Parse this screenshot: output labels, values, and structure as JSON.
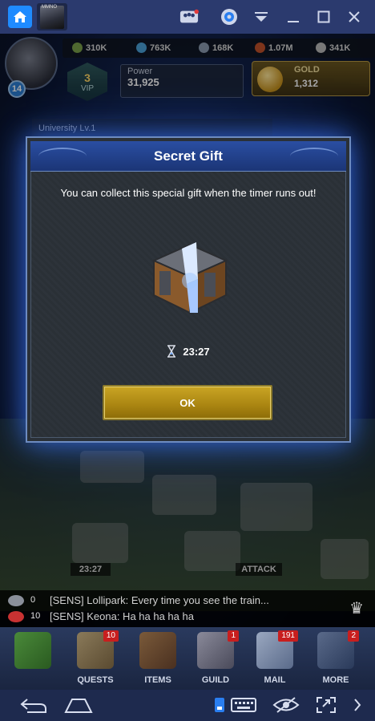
{
  "emulator": {
    "home_icon": "house-icon",
    "app_tab_icon": "game-thumbnail",
    "app_tab_text": "MMNO",
    "toolbar": [
      {
        "name": "multi-instance-icon",
        "glyph": "👥"
      },
      {
        "name": "account-icon",
        "glyph": "●"
      },
      {
        "name": "dropdown-menu-icon",
        "glyph": "▼"
      },
      {
        "name": "minimize-icon",
        "glyph": "—"
      },
      {
        "name": "maximize-icon",
        "glyph": "▢"
      },
      {
        "name": "close-icon",
        "glyph": "✕"
      }
    ]
  },
  "hud": {
    "resources": [
      {
        "name": "food",
        "value": "310K",
        "color": "#7aa04a"
      },
      {
        "name": "stone",
        "value": "763K",
        "color": "#4aa0d8"
      },
      {
        "name": "iron",
        "value": "168K",
        "color": "#8a9ab0"
      },
      {
        "name": "wood",
        "value": "1.07M",
        "color": "#c0502a"
      },
      {
        "name": "silver",
        "value": "341K",
        "color": "#b8b8b8"
      }
    ],
    "level": "14",
    "vip": {
      "value": "3",
      "label": "VIP"
    },
    "power": {
      "label": "Power",
      "value": "31,925"
    },
    "gold": {
      "label": "GOLD",
      "value": "1,312"
    },
    "building_label": "University Lv.1"
  },
  "dialog": {
    "title": "Secret Gift",
    "message": "You can collect this special gift when the timer runs out!",
    "timer_icon": "hourglass-icon",
    "timer": "23:27",
    "ok_label": "OK"
  },
  "map_labels": {
    "timer": "23:27",
    "attack": "ATTACK"
  },
  "chat": {
    "lines": [
      {
        "count": "0",
        "text": "[SENS] Lollipark: Every time you see the train..."
      },
      {
        "count": "10",
        "text": "[SENS] Keona: Ha ha ha ha ha"
      }
    ]
  },
  "nav": [
    {
      "id": "realm",
      "label": "",
      "badge": ""
    },
    {
      "id": "quests",
      "label": "QUESTS",
      "badge": "10"
    },
    {
      "id": "items",
      "label": "ITEMS",
      "badge": ""
    },
    {
      "id": "guild",
      "label": "GUILD",
      "badge": "1"
    },
    {
      "id": "mail",
      "label": "MAIL",
      "badge": "191"
    },
    {
      "id": "more",
      "label": "MORE",
      "badge": "2"
    }
  ],
  "system_bar": [
    {
      "name": "back-icon",
      "glyph": "↶"
    },
    {
      "name": "home-icon",
      "glyph": "⌂"
    },
    {
      "name": "screen-icon",
      "glyph": "▯"
    },
    {
      "name": "keyboard-icon",
      "glyph": "⌨"
    },
    {
      "name": "visibility-icon",
      "glyph": "👁"
    },
    {
      "name": "fullscreen-icon",
      "glyph": "⤢"
    },
    {
      "name": "next-icon",
      "glyph": "›"
    }
  ]
}
